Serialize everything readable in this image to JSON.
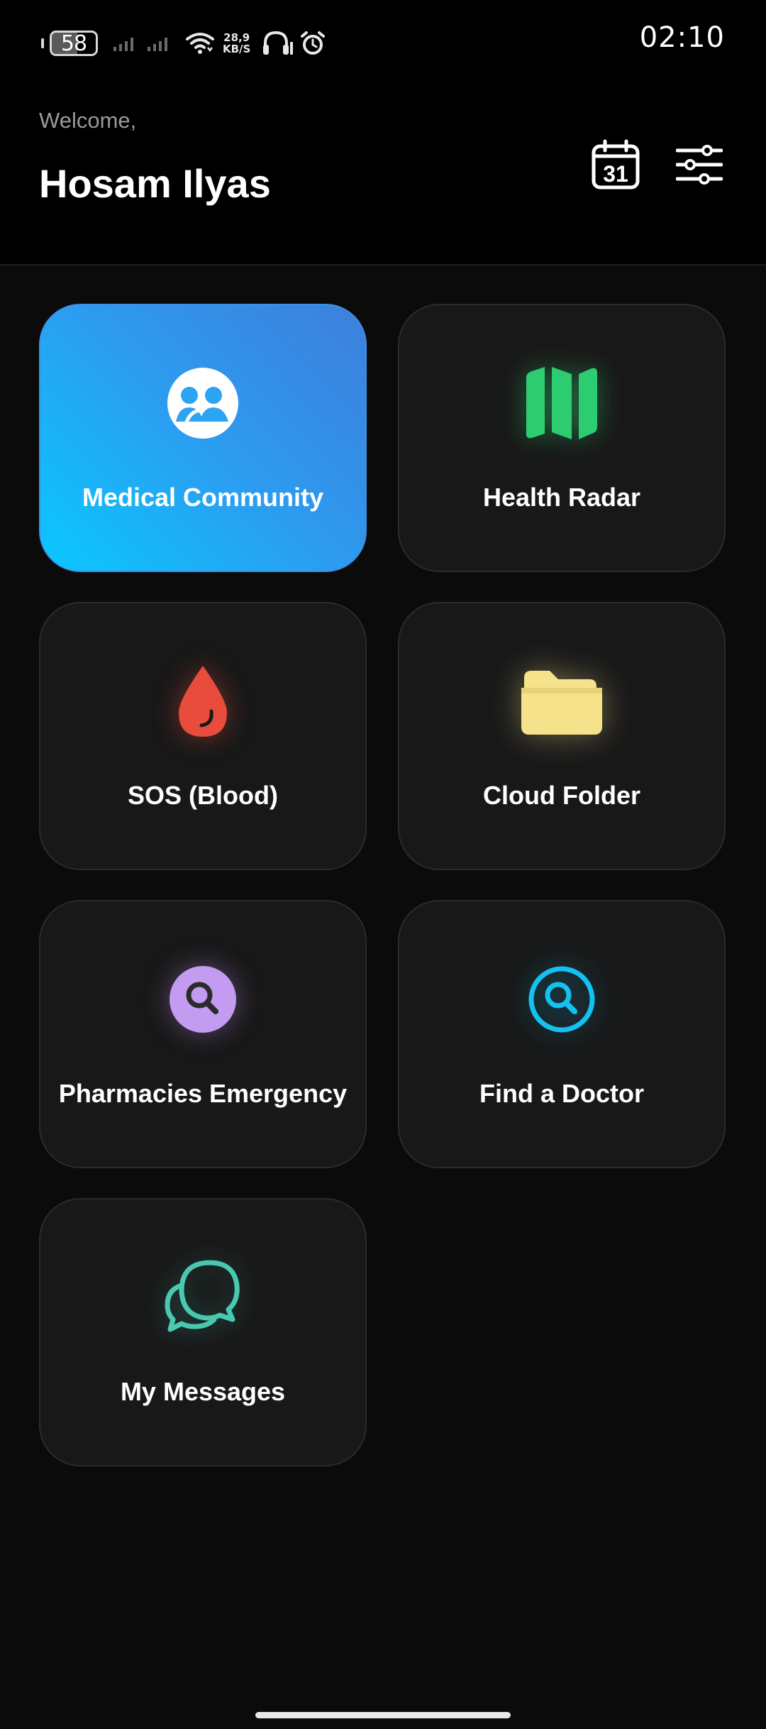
{
  "status_bar": {
    "battery_level": "58",
    "battery_fraction": 0.58,
    "network_speed_value": "28,9",
    "network_speed_unit": "KB/S",
    "time": "02:10"
  },
  "header": {
    "greeting": "Welcome,",
    "user_name": "Hosam Ilyas",
    "calendar_day": "31"
  },
  "features": [
    {
      "label": "Medical Community",
      "icon": "community-icon",
      "active": true
    },
    {
      "label": "Health Radar",
      "icon": "map-icon",
      "color": "#2ecc71"
    },
    {
      "label": "SOS (Blood)",
      "icon": "blood-drop-icon",
      "color": "#e74c3c"
    },
    {
      "label": "Cloud Folder",
      "icon": "folder-icon",
      "color": "#f7e28c"
    },
    {
      "label": "Pharmacies Emergency",
      "icon": "search-icon",
      "color": "#c39bf0"
    },
    {
      "label": "Find a Doctor",
      "icon": "search-icon",
      "color": "#14c1f0"
    },
    {
      "label": "My Messages",
      "icon": "chat-bubbles-icon",
      "color": "#48c9b0"
    }
  ],
  "colors": {
    "background": "#0b0b0b",
    "card": "#181818",
    "active_gradient_start": "#0ac8ff",
    "active_gradient_end": "#3e7fdb"
  }
}
